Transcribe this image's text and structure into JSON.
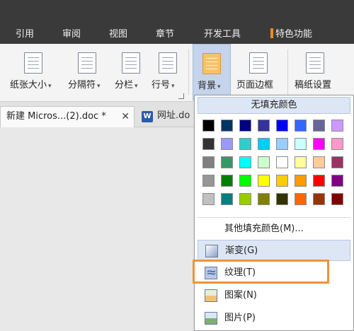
{
  "menu_tabs": [
    "引用",
    "审阅",
    "视图",
    "章节",
    "开发工具",
    "特色功能"
  ],
  "ribbon": {
    "paper_size": "纸张大小",
    "separator": "分隔符",
    "columns": "分栏",
    "line_no": "行号",
    "background": "背景",
    "page_border": "页面边框",
    "manuscript": "稿纸设置"
  },
  "doc_tabs": {
    "active": "新建 Micros...(2).doc *",
    "active_close": "✕",
    "inactive": "网址.do",
    "inactive_icon": "W"
  },
  "dropdown": {
    "no_fill": "无填充颜色",
    "more_colors": "其他填充颜色(M)...",
    "gradient": "渐变(G)",
    "texture": "纹理(T)",
    "pattern": "图案(N)",
    "picture": "图片(P)"
  },
  "swatch_colors": [
    [
      "#000000",
      "#003366",
      "#000080",
      "#333399",
      "#0000ff",
      "#3366ff",
      "#666699",
      "#cc99ff"
    ],
    [
      "#333333",
      "#9999ff",
      "#33cccc",
      "#00ccff",
      "#99ccff",
      "#ccffff",
      "#ff00ff",
      "#ff99cc"
    ],
    [
      "#808080",
      "#339966",
      "#00ffff",
      "#ccffcc",
      "#ffffff",
      "#ffff99",
      "#ffcc99",
      "#993366"
    ],
    [
      "#969696",
      "#008000",
      "#00ff00",
      "#ffff00",
      "#ffcc00",
      "#ff9900",
      "#ff0000",
      "#800080"
    ],
    [
      "#c0c0c0",
      "#008080",
      "#99cc00",
      "#808000",
      "#333300",
      "#ff6600",
      "#993300",
      "#800000"
    ]
  ],
  "accent_color": "#f08a24"
}
